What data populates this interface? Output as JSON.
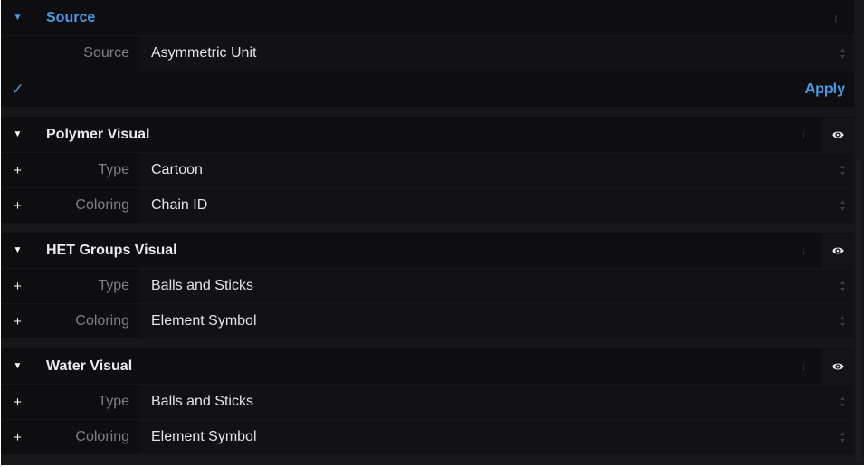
{
  "source_section": {
    "toggle": "▼",
    "title": "Source",
    "info": "i",
    "field": {
      "label": "Source",
      "value": "Asymmetric Unit"
    },
    "check": "✓",
    "apply_label": "Apply"
  },
  "sections": [
    {
      "toggle": "▼",
      "title": "Polymer Visual",
      "info": "i",
      "rows": [
        {
          "toggle": "+",
          "label": "Type",
          "value": "Cartoon"
        },
        {
          "toggle": "+",
          "label": "Coloring",
          "value": "Chain ID"
        }
      ]
    },
    {
      "toggle": "▼",
      "title": "HET Groups Visual",
      "info": "i",
      "rows": [
        {
          "toggle": "+",
          "label": "Type",
          "value": "Balls and Sticks"
        },
        {
          "toggle": "+",
          "label": "Coloring",
          "value": "Element Symbol"
        }
      ]
    },
    {
      "toggle": "▼",
      "title": "Water Visual",
      "info": "i",
      "rows": [
        {
          "toggle": "+",
          "label": "Type",
          "value": "Balls and Sticks"
        },
        {
          "toggle": "+",
          "label": "Coloring",
          "value": "Element Symbol"
        }
      ]
    }
  ],
  "colors": {
    "accent": "#4a9ae8",
    "background": "#17171a",
    "row": "#0e0e10"
  },
  "icons": {
    "info": "info-icon",
    "eye": "eye-icon",
    "spinner": "updown-arrows-icon",
    "expand": "plus-icon",
    "collapse": "triangle-down-icon",
    "check": "checkmark-icon"
  }
}
